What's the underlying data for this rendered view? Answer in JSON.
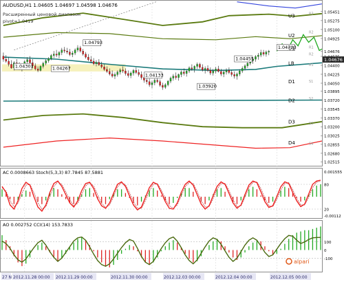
{
  "header": {
    "symbol_line": "AUDUSD,H1  1.04605 1.04697 1.04598 1.04676",
    "indicator_title": "Расширенный ценовой диапазон",
    "pivot_line": "pivot=1.0419"
  },
  "colors": {
    "bull_candle": "#22aa22",
    "bear_candle": "#dd2222",
    "pivot_line": "#1a7a7a",
    "level_lines": "#5a7a10",
    "u4_line": "#3344dd",
    "d4_line": "#ee2222",
    "price_line": "#22aa22",
    "stoch_line": "#ee2222",
    "cci_line": "#4a6a10",
    "zone": "#f5eeb0"
  },
  "price_axis": [
    "1.05451",
    "1.05275",
    "1.05100",
    "1.04925",
    "1.04676",
    "1.04575",
    "1.04400",
    "1.04225",
    "1.04050",
    "1.03895",
    "1.03720",
    "1.03545",
    "1.03370",
    "1.03200",
    "1.03025",
    "1.02855",
    "1.02680",
    "1.02515"
  ],
  "level_labels": [
    {
      "key": "U3",
      "y": 1.05365
    },
    {
      "key": "U2",
      "y": 1.04985
    },
    {
      "key": "U1",
      "y": 1.04735
    },
    {
      "key": "LB",
      "y": 1.0444
    },
    {
      "key": "D1",
      "y": 1.04085
    },
    {
      "key": "D2",
      "y": 1.03715
    },
    {
      "key": "D3",
      "y": 1.03295
    },
    {
      "key": "D4",
      "y": 1.02885
    }
  ],
  "level_inner_labels": [
    {
      "key": "R3",
      "y": 1.0542
    },
    {
      "key": "R2",
      "y": 1.0506
    },
    {
      "key": "R1",
      "y": 1.0476
    },
    {
      "key": "R2",
      "y": 1.0463
    },
    {
      "key": "R1",
      "y": 1.0442
    },
    {
      "key": "S1",
      "y": 1.041
    },
    {
      "key": "S2",
      "y": 1.0376
    },
    {
      "key": "S3",
      "y": 1.0328
    },
    {
      "key": "S4",
      "y": 1.0288
    }
  ],
  "price_annotations": [
    {
      "text": "1.04793",
      "x": 30,
      "y": 1.04793
    },
    {
      "text": "1.04301",
      "x": 4,
      "y": 1.0433
    },
    {
      "text": "1.04267",
      "x": 18,
      "y": 1.0429
    },
    {
      "text": "1.04133",
      "x": 53,
      "y": 1.0416
    },
    {
      "text": "1.04455",
      "x": 87,
      "y": 1.0448
    },
    {
      "text": "1.03920",
      "x": 73,
      "y": 1.0394
    },
    {
      "text": "1.04703",
      "x": 103,
      "y": 1.04703
    }
  ],
  "current_price": "1.04676",
  "time_axis": [
    "27 N",
    "2012.11.28 00:00",
    "2012.11.29 00:00",
    "2012.11.30 00:00",
    "2012.12.03 00:00",
    "2012.12.04 00:00",
    "2012.12.05 00:00"
  ],
  "ac_panel": {
    "label": "AC 0.0008663  Stoch(5,3,3) 87.7845 87.5881",
    "axis": [
      "0.001555",
      "80",
      "20",
      "-0.00112"
    ],
    "stoch_levels": [
      80,
      20
    ],
    "ylim": [
      0,
      100
    ]
  },
  "ao_panel": {
    "label": "AO 0.002752  CCI(14) 153.7833",
    "axis": [
      "100",
      "0",
      "-100"
    ],
    "cci_levels": [
      100,
      -100
    ],
    "ylim": [
      -250,
      250
    ],
    "logo": "alpari"
  },
  "chart_data": {
    "type": "candlestick",
    "symbol": "AUDUSD",
    "timeframe": "H1",
    "ylim": [
      1.0245,
      1.0565
    ],
    "x_count": 120,
    "candles": [
      [
        1.0458,
        1.0465,
        1.0447,
        1.0452
      ],
      [
        1.0452,
        1.046,
        1.0445,
        1.0448
      ],
      [
        1.0448,
        1.0456,
        1.0438,
        1.0442
      ],
      [
        1.0442,
        1.045,
        1.0433,
        1.0435
      ],
      [
        1.0435,
        1.0448,
        1.04301,
        1.0445
      ],
      [
        1.0445,
        1.0452,
        1.0436,
        1.0438
      ],
      [
        1.0438,
        1.0446,
        1.0431,
        1.0434
      ],
      [
        1.0434,
        1.0442,
        1.0428,
        1.044
      ],
      [
        1.044,
        1.045,
        1.0438,
        1.0447
      ],
      [
        1.0447,
        1.0456,
        1.0442,
        1.0451
      ],
      [
        1.0451,
        1.0458,
        1.0443,
        1.0445
      ],
      [
        1.0445,
        1.0452,
        1.0436,
        1.0439
      ],
      [
        1.0439,
        1.0444,
        1.043,
        1.0433
      ],
      [
        1.0433,
        1.0438,
        1.04267,
        1.043
      ],
      [
        1.043,
        1.044,
        1.0428,
        1.0438
      ],
      [
        1.0438,
        1.0447,
        1.0434,
        1.0444
      ],
      [
        1.0444,
        1.0452,
        1.044,
        1.0449
      ],
      [
        1.0449,
        1.0456,
        1.0445,
        1.0453
      ],
      [
        1.0453,
        1.0462,
        1.045,
        1.0459
      ],
      [
        1.0459,
        1.0468,
        1.0454,
        1.0462
      ],
      [
        1.0462,
        1.047,
        1.0456,
        1.046
      ],
      [
        1.046,
        1.0468,
        1.0454,
        1.0465
      ],
      [
        1.0465,
        1.0474,
        1.046,
        1.047
      ],
      [
        1.047,
        1.0476,
        1.0464,
        1.0468
      ],
      [
        1.0468,
        1.0474,
        1.0462,
        1.0466
      ],
      [
        1.0466,
        1.0472,
        1.0458,
        1.0461
      ],
      [
        1.0461,
        1.0468,
        1.0456,
        1.0464
      ],
      [
        1.0464,
        1.0473,
        1.046,
        1.047
      ],
      [
        1.047,
        1.04793,
        1.0466,
        1.0474
      ],
      [
        1.0474,
        1.0478,
        1.0465,
        1.0468
      ],
      [
        1.0468,
        1.0472,
        1.0459,
        1.0462
      ],
      [
        1.0462,
        1.0466,
        1.0453,
        1.0456
      ],
      [
        1.0456,
        1.0462,
        1.0448,
        1.0451
      ],
      [
        1.0451,
        1.0458,
        1.0444,
        1.0448
      ],
      [
        1.0448,
        1.0454,
        1.044,
        1.0443
      ],
      [
        1.0443,
        1.045,
        1.0438,
        1.0446
      ],
      [
        1.0446,
        1.0452,
        1.0439,
        1.0441
      ],
      [
        1.0441,
        1.0447,
        1.0434,
        1.0437
      ],
      [
        1.0437,
        1.0442,
        1.0429,
        1.0432
      ],
      [
        1.0432,
        1.0438,
        1.0425,
        1.0428
      ],
      [
        1.0428,
        1.0434,
        1.042,
        1.0423
      ],
      [
        1.0423,
        1.043,
        1.0416,
        1.0419
      ],
      [
        1.0419,
        1.0426,
        1.04133,
        1.0422
      ],
      [
        1.0422,
        1.043,
        1.0418,
        1.0427
      ],
      [
        1.0427,
        1.0434,
        1.0422,
        1.0431
      ],
      [
        1.0431,
        1.0438,
        1.0425,
        1.0429
      ],
      [
        1.0429,
        1.0434,
        1.042,
        1.0424
      ],
      [
        1.0424,
        1.043,
        1.0416,
        1.042
      ],
      [
        1.042,
        1.0428,
        1.0415,
        1.0425
      ],
      [
        1.0425,
        1.0433,
        1.042,
        1.043
      ],
      [
        1.043,
        1.0436,
        1.0423,
        1.0426
      ],
      [
        1.0426,
        1.0432,
        1.0418,
        1.0422
      ],
      [
        1.0422,
        1.0428,
        1.0412,
        1.0416
      ],
      [
        1.0416,
        1.0422,
        1.0406,
        1.0411
      ],
      [
        1.0411,
        1.0418,
        1.0403,
        1.0408
      ],
      [
        1.0408,
        1.0414,
        1.0398,
        1.0402
      ],
      [
        1.0402,
        1.041,
        1.0395,
        1.0406
      ],
      [
        1.0406,
        1.0414,
        1.0401,
        1.0411
      ],
      [
        1.0411,
        1.0418,
        1.0405,
        1.0408
      ],
      [
        1.0408,
        1.0412,
        1.0398,
        1.0401
      ],
      [
        1.0401,
        1.0406,
        1.0392,
        1.0397
      ],
      [
        1.0397,
        1.0405,
        1.0394,
        1.0402
      ],
      [
        1.0402,
        1.0411,
        1.0399,
        1.0409
      ],
      [
        1.0409,
        1.0418,
        1.0405,
        1.0415
      ],
      [
        1.0415,
        1.0423,
        1.041,
        1.0419
      ],
      [
        1.0419,
        1.0426,
        1.0412,
        1.0416
      ],
      [
        1.0416,
        1.0424,
        1.041,
        1.0422
      ],
      [
        1.0422,
        1.043,
        1.0417,
        1.0427
      ],
      [
        1.0427,
        1.0434,
        1.042,
        1.0424
      ],
      [
        1.0424,
        1.0431,
        1.0418,
        1.0429
      ],
      [
        1.0429,
        1.0438,
        1.0425,
        1.0435
      ],
      [
        1.0435,
        1.0442,
        1.0429,
        1.0433
      ],
      [
        1.0433,
        1.044,
        1.0426,
        1.0438
      ],
      [
        1.0438,
        1.04455,
        1.0433,
        1.0442
      ],
      [
        1.0442,
        1.0445,
        1.0433,
        1.0436
      ],
      [
        1.0436,
        1.0442,
        1.0428,
        1.0431
      ],
      [
        1.0431,
        1.0438,
        1.0424,
        1.0434
      ],
      [
        1.0434,
        1.044,
        1.0427,
        1.043
      ],
      [
        1.043,
        1.0436,
        1.0421,
        1.0425
      ],
      [
        1.0425,
        1.0433,
        1.042,
        1.0429
      ],
      [
        1.0429,
        1.0437,
        1.0424,
        1.0433
      ],
      [
        1.0433,
        1.0439,
        1.0426,
        1.0428
      ],
      [
        1.0428,
        1.0433,
        1.0419,
        1.0423
      ],
      [
        1.0423,
        1.043,
        1.0417,
        1.0427
      ],
      [
        1.0427,
        1.0434,
        1.0422,
        1.043
      ],
      [
        1.043,
        1.0436,
        1.0423,
        1.0426
      ],
      [
        1.0426,
        1.0431,
        1.0418,
        1.0422
      ],
      [
        1.0422,
        1.0428,
        1.0414,
        1.0419
      ],
      [
        1.0419,
        1.0426,
        1.0412,
        1.0423
      ],
      [
        1.0423,
        1.0432,
        1.0419,
        1.0429
      ],
      [
        1.0429,
        1.0438,
        1.0425,
        1.0434
      ],
      [
        1.0434,
        1.0442,
        1.043,
        1.0439
      ],
      [
        1.0439,
        1.0447,
        1.0435,
        1.0444
      ],
      [
        1.0444,
        1.0452,
        1.044,
        1.0449
      ],
      [
        1.0449,
        1.0456,
        1.0443,
        1.0452
      ],
      [
        1.0452,
        1.046,
        1.0447,
        1.0457
      ],
      [
        1.0457,
        1.0464,
        1.0451,
        1.046
      ],
      [
        1.046,
        1.04703,
        1.0456,
        1.0465
      ],
      [
        1.0465,
        1.047,
        1.0458,
        1.0462
      ],
      [
        1.0462,
        1.0469,
        1.0457,
        1.0466
      ],
      [
        1.0466,
        1.047,
        1.04598,
        1.04676
      ]
    ],
    "forecast_path": [
      [
        103,
        1.04676
      ],
      [
        105,
        1.0482
      ],
      [
        107,
        1.047
      ],
      [
        109,
        1.049
      ],
      [
        111,
        1.0478
      ],
      [
        113,
        1.05
      ],
      [
        115,
        1.0485
      ],
      [
        117,
        1.0495
      ],
      [
        119,
        1.0469
      ],
      [
        120,
        1.0472
      ]
    ],
    "pivot_line": [
      [
        0,
        1.0456
      ],
      [
        20,
        1.0452
      ],
      [
        40,
        1.0442
      ],
      [
        60,
        1.0433
      ],
      [
        80,
        1.043
      ],
      [
        95,
        1.0432
      ],
      [
        103,
        1.0438
      ],
      [
        120,
        1.0445
      ]
    ],
    "u3_line": [
      [
        0,
        1.0518
      ],
      [
        15,
        1.0533
      ],
      [
        30,
        1.0542
      ],
      [
        45,
        1.053
      ],
      [
        60,
        1.0518
      ],
      [
        75,
        1.0525
      ],
      [
        85,
        1.0537
      ],
      [
        100,
        1.054
      ],
      [
        110,
        1.0536
      ],
      [
        120,
        1.0541
      ]
    ],
    "u2_line": [
      [
        0,
        1.0495
      ],
      [
        20,
        1.0504
      ],
      [
        40,
        1.0502
      ],
      [
        60,
        1.0492
      ],
      [
        80,
        1.049
      ],
      [
        95,
        1.0496
      ],
      [
        108,
        1.0492
      ],
      [
        120,
        1.0498
      ]
    ],
    "d2_line": [
      [
        0,
        1.037
      ],
      [
        120,
        1.0372
      ]
    ],
    "d3_line": [
      [
        0,
        1.0333
      ],
      [
        15,
        1.0342
      ],
      [
        30,
        1.0345
      ],
      [
        45,
        1.0338
      ],
      [
        60,
        1.0328
      ],
      [
        75,
        1.032
      ],
      [
        90,
        1.0318
      ],
      [
        105,
        1.0318
      ],
      [
        120,
        1.033
      ]
    ],
    "d4_line": [
      [
        0,
        1.028
      ],
      [
        20,
        1.0292
      ],
      [
        40,
        1.0298
      ],
      [
        60,
        1.0292
      ],
      [
        80,
        1.0284
      ],
      [
        95,
        1.0278
      ],
      [
        108,
        1.0279
      ],
      [
        120,
        1.0292
      ]
    ],
    "u4_line": [
      [
        88,
        1.0564
      ],
      [
        100,
        1.0556
      ],
      [
        110,
        1.0552
      ],
      [
        120,
        1.056
      ]
    ],
    "zone_band": [
      1.0428,
      1.0442
    ],
    "stoch_k": [
      75,
      60,
      30,
      20,
      40,
      70,
      85,
      78,
      50,
      25,
      15,
      30,
      60,
      82,
      88,
      75,
      55,
      35,
      25,
      40,
      65,
      82,
      85,
      70,
      45,
      28,
      22,
      35,
      58,
      80,
      86,
      75,
      52,
      30,
      18,
      25,
      48,
      72,
      85,
      80,
      60,
      38,
      22,
      20,
      35,
      60,
      80,
      88,
      78,
      55,
      32,
      20,
      28,
      52,
      75,
      86,
      80,
      58,
      35,
      22,
      30,
      55,
      78,
      88,
      84,
      62,
      38,
      24,
      28,
      50,
      74,
      86,
      82,
      60,
      40,
      26,
      32,
      56,
      80,
      88,
      90
    ],
    "stoch_d": [
      72,
      64,
      40,
      26,
      34,
      58,
      78,
      80,
      60,
      35,
      20,
      26,
      50,
      75,
      86,
      80,
      62,
      42,
      28,
      34,
      56,
      76,
      84,
      76,
      55,
      34,
      24,
      30,
      50,
      74,
      84,
      79,
      60,
      38,
      22,
      22,
      40,
      64,
      80,
      82,
      66,
      45,
      28,
      22,
      30,
      52,
      74,
      85,
      82,
      63,
      40,
      25,
      26,
      45,
      68,
      82,
      82,
      65,
      42,
      26,
      28,
      48,
      72,
      85,
      86,
      70,
      46,
      28,
      26,
      43,
      66,
      82,
      84,
      67,
      46,
      30,
      30,
      48,
      72,
      85,
      88
    ],
    "ac_hist": [
      0.6,
      0.3,
      -0.2,
      -0.6,
      -0.3,
      0.2,
      0.5,
      0.4,
      0.0,
      -0.4,
      -0.6,
      -0.3,
      0.3,
      0.7,
      0.6,
      0.2,
      -0.2,
      -0.5,
      -0.6,
      -0.3,
      0.2,
      0.6,
      0.7,
      0.3,
      -0.2,
      -0.5,
      -0.6,
      -0.2,
      0.3,
      0.6,
      0.6,
      0.3,
      -0.1,
      -0.5,
      -0.7,
      -0.4,
      0.1,
      0.5,
      0.7,
      0.5,
      0.1,
      -0.3,
      -0.6,
      -0.5,
      -0.1,
      0.4,
      0.7,
      0.7,
      0.4,
      0.0,
      -0.4,
      -0.6,
      -0.3,
      0.2,
      0.6,
      0.7,
      0.4,
      0.0,
      -0.4,
      -0.6,
      -0.3,
      0.2,
      0.6,
      0.8,
      0.6,
      0.1,
      -0.3,
      -0.5,
      -0.4,
      0.1,
      0.5,
      0.8,
      0.7,
      0.3,
      -0.1,
      -0.4,
      -0.3,
      0.2,
      0.6,
      0.9,
      1.0
    ],
    "ao_hist": [
      1.2,
      0.8,
      0.3,
      -0.5,
      -1.0,
      -1.3,
      -1.1,
      -0.6,
      0.0,
      0.4,
      0.6,
      0.3,
      -0.2,
      -0.6,
      -0.9,
      -0.7,
      -0.3,
      0.2,
      0.6,
      0.9,
      1.0,
      0.8,
      0.4,
      -0.1,
      -0.6,
      -1.0,
      -1.3,
      -1.4,
      -1.2,
      -0.8,
      -0.3,
      0.1,
      0.4,
      0.3,
      -0.1,
      -0.6,
      -1.0,
      -1.2,
      -1.0,
      -0.6,
      -0.1,
      0.3,
      0.6,
      0.8,
      0.6,
      0.2,
      -0.3,
      -0.7,
      -1.0,
      -0.9,
      -0.5,
      0.0,
      0.4,
      0.7,
      0.9,
      0.7,
      0.3,
      -0.2,
      -0.6,
      -0.8,
      -0.6,
      -0.2,
      0.3,
      0.6,
      0.8,
      0.7,
      0.3,
      -0.1,
      -0.4,
      -0.3,
      0.1,
      0.5,
      0.9,
      1.2,
      1.4,
      1.5,
      1.6,
      1.6,
      1.7,
      1.8,
      1.9
    ],
    "cci": [
      110,
      80,
      20,
      -60,
      -120,
      -150,
      -110,
      -40,
      30,
      90,
      120,
      60,
      -20,
      -90,
      -140,
      -100,
      -30,
      40,
      110,
      150,
      160,
      120,
      40,
      -50,
      -130,
      -180,
      -200,
      -170,
      -110,
      -40,
      30,
      90,
      130,
      110,
      20,
      -80,
      -150,
      -180,
      -140,
      -60,
      20,
      90,
      140,
      160,
      110,
      30,
      -60,
      -130,
      -170,
      -120,
      -40,
      40,
      110,
      150,
      130,
      70,
      -10,
      -90,
      -140,
      -100,
      -20,
      60,
      120,
      150,
      120,
      50,
      -30,
      -80,
      -60,
      10,
      80,
      140,
      180,
      170,
      120,
      80,
      100,
      130,
      150,
      154,
      155
    ]
  }
}
